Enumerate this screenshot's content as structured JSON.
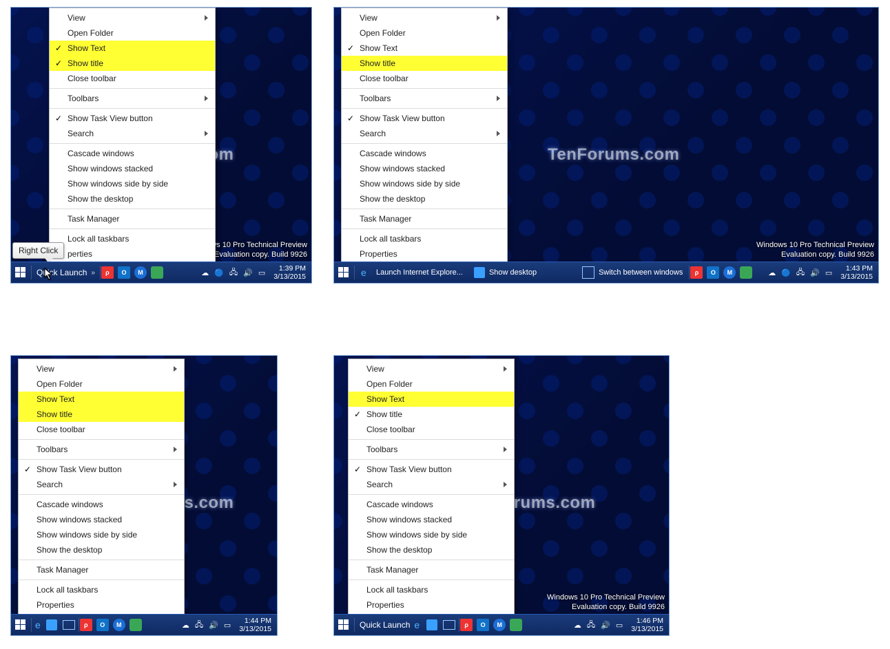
{
  "watermark": "TenForums.com",
  "build": {
    "line1": "Windows 10 Pro Technical Preview",
    "line2": "Evaluation copy. Build 9926"
  },
  "tooltip": "Right Click",
  "menu": {
    "view": "View",
    "open_folder": "Open Folder",
    "show_text": "Show Text",
    "show_title": "Show title",
    "close_toolbar": "Close toolbar",
    "toolbars": "Toolbars",
    "show_taskview": "Show Task View button",
    "search": "Search",
    "cascade": "Cascade windows",
    "stacked": "Show windows stacked",
    "sidebyside": "Show windows side by side",
    "desktop": "Show the desktop",
    "task_manager": "Task Manager",
    "lock": "Lock all taskbars",
    "properties": "Properties",
    "properties_clip": "perties"
  },
  "taskbar": {
    "quick_launch": "Quick Launch",
    "launch_ie": "Launch Internet Explore...",
    "show_desktop": "Show desktop",
    "switch_windows": "Switch between windows"
  },
  "clocks": {
    "p1": {
      "time": "1:39 PM",
      "date": "3/13/2015"
    },
    "p2": {
      "time": "1:43 PM",
      "date": "3/13/2015"
    },
    "p3": {
      "time": "1:44 PM",
      "date": "3/13/2015"
    },
    "p4": {
      "time": "1:46 PM",
      "date": "3/13/2015"
    }
  },
  "build_clip": {
    "line1": "ws 10 Pro Technical Preview",
    "line2": "Evaluation copy. Build 9926"
  }
}
